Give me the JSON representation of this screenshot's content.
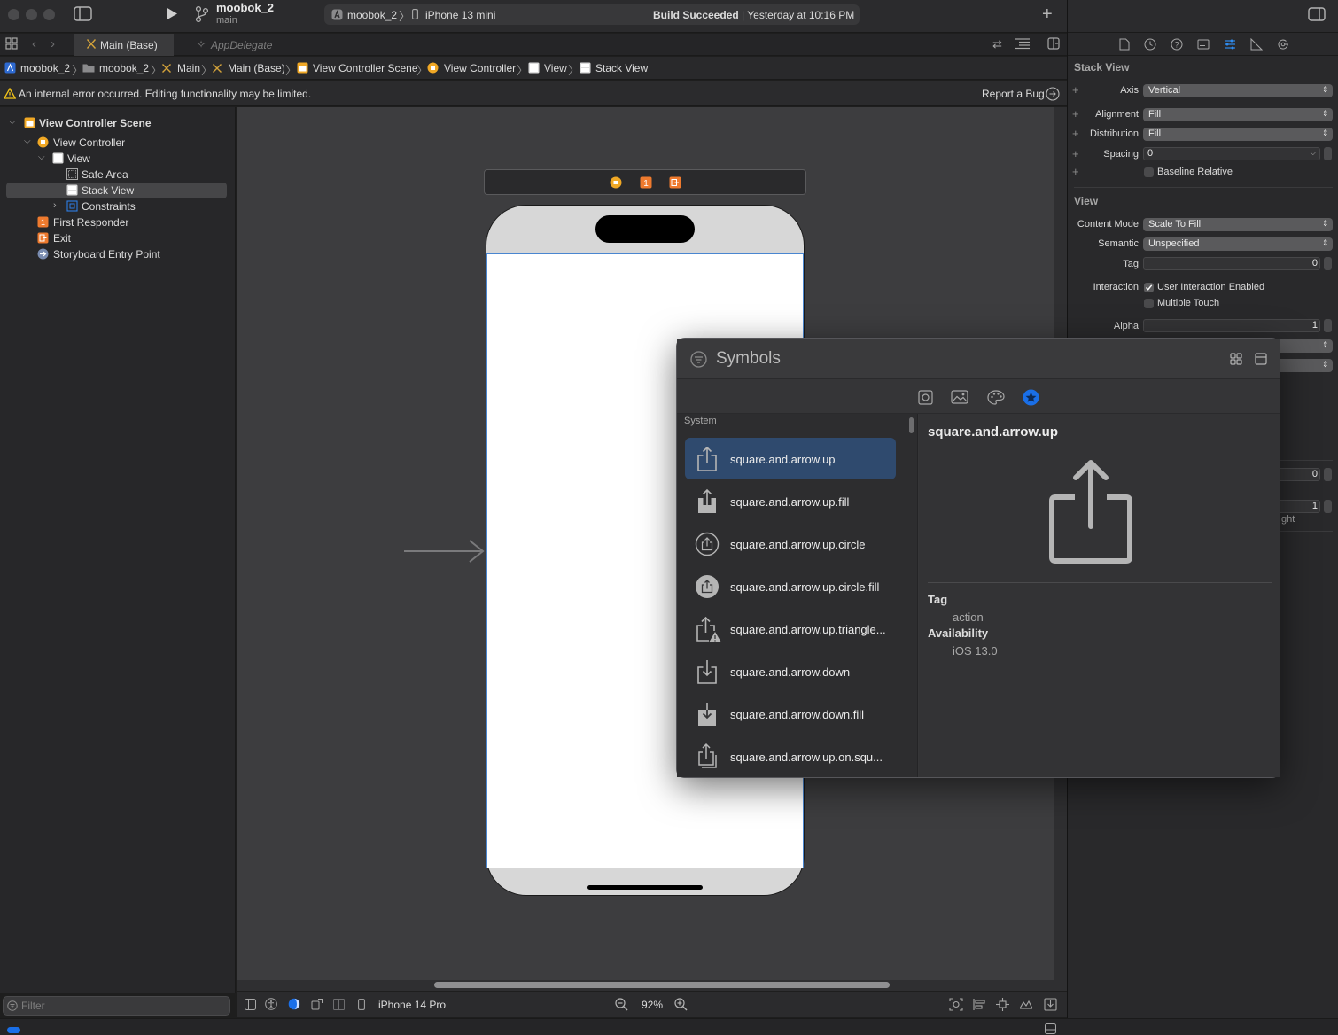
{
  "toolbar": {
    "project_name": "moobok_2",
    "branch": "main",
    "scheme": "moobok_2",
    "device": "iPhone 13 mini",
    "build_status_bold": "Build Succeeded",
    "build_status_rest": " | Yesterday at 10:16 PM"
  },
  "tabs": {
    "main": "Main (Base)",
    "app_delegate": "AppDelegate"
  },
  "breadcrumb": [
    "moobok_2",
    "moobok_2",
    "Main",
    "Main (Base)",
    "View Controller Scene",
    "View Controller",
    "View",
    "Stack View"
  ],
  "warning": {
    "text": "An internal error occurred. Editing functionality may be limited.",
    "report_bug": "Report a Bug"
  },
  "outline": {
    "scene": "View Controller Scene",
    "view_controller": "View Controller",
    "view": "View",
    "safe_area": "Safe Area",
    "stack_view": "Stack View",
    "constraints": "Constraints",
    "first_responder": "First Responder",
    "exit": "Exit",
    "entry_point": "Storyboard Entry Point",
    "filter_placeholder": "Filter"
  },
  "bottom_bar": {
    "device_config": "iPhone 14 Pro",
    "zoom": "92%"
  },
  "inspector": {
    "stack_heading": "Stack View",
    "axis_label": "Axis",
    "axis_value": "Vertical",
    "alignment_label": "Alignment",
    "alignment_value": "Fill",
    "distribution_label": "Distribution",
    "distribution_value": "Fill",
    "spacing_label": "Spacing",
    "spacing_value": "0",
    "baseline_relative": "Baseline Relative",
    "view_heading": "View",
    "content_mode_label": "Content Mode",
    "content_mode_value": "Scale To Fill",
    "semantic_label": "Semantic",
    "semantic_value": "Unspecified",
    "tag_label": "Tag",
    "tag_value": "0",
    "interaction_label": "Interaction",
    "user_interaction": "User Interaction Enabled",
    "multiple_touch": "Multiple Touch",
    "alpha_label": "Alpha",
    "alpha_value": "1",
    "field_a_value": "0",
    "field_b_value": "1",
    "partial_text": "ght"
  },
  "symbols": {
    "title": "Symbols",
    "section": "System",
    "items": [
      {
        "name": "square.and.arrow.up",
        "icon": "share-icon"
      },
      {
        "name": "square.and.arrow.up.fill",
        "icon": "share-fill-icon"
      },
      {
        "name": "square.and.arrow.up.circle",
        "icon": "share-circle-icon"
      },
      {
        "name": "square.and.arrow.up.circle.fill",
        "icon": "share-circle-fill-icon"
      },
      {
        "name": "square.and.arrow.up.triangle...",
        "icon": "share-triangle-icon"
      },
      {
        "name": "square.and.arrow.down",
        "icon": "download-icon"
      },
      {
        "name": "square.and.arrow.down.fill",
        "icon": "download-fill-icon"
      },
      {
        "name": "square.and.arrow.up.on.squ...",
        "icon": "share-on-square-icon"
      }
    ],
    "detail": {
      "name": "square.and.arrow.up",
      "tag_heading": "Tag",
      "tag_value": "action",
      "availability_heading": "Availability",
      "availability_value": "iOS 13.0"
    }
  },
  "colors": {
    "accent": "#1a6fe8",
    "selection": "#2f4a6e",
    "warning": "#f5c518"
  }
}
